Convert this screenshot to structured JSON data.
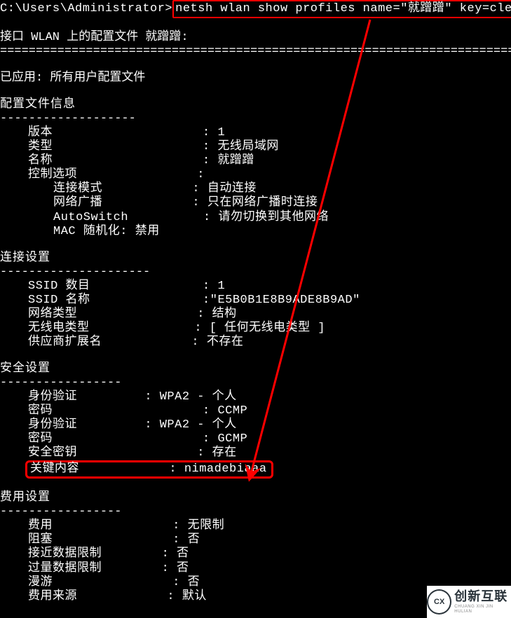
{
  "prompt": {
    "path": "C:\\Users\\Administrator>",
    "command": "netsh wlan show profiles name=\"就蹭蹭\" key=clear"
  },
  "header_line": "接口 WLAN 上的配置文件 就蹭蹭:",
  "hr_full": "=========================================================================",
  "applied": "已应用: 所有用户配置文件",
  "sec_profile": {
    "title": "配置文件信息",
    "hr": "-------------------",
    "rows": {
      "version_k": "版本",
      "version_v": "1",
      "type_k": "类型",
      "type_v": "无线局域网",
      "name_k": "名称",
      "name_v": "就蹭蹭",
      "ctrl_k": "控制选项",
      "ctrl_v": "",
      "conn_mode_k": "连接模式",
      "conn_mode_v": "自动连接",
      "broadcast_k": "网络广播",
      "broadcast_v": "只在网络广播时连接",
      "autoswitch_k": "AutoSwitch",
      "autoswitch_v": "请勿切换到其他网络",
      "macrand_line": "MAC 随机化: 禁用"
    }
  },
  "sec_conn": {
    "title": "连接设置",
    "hr": "---------------------",
    "rows": {
      "ssid_cnt_k": "SSID 数目",
      "ssid_cnt_v": "1",
      "ssid_name_k": "SSID 名称",
      "ssid_name_v": "\"E5B0B1E8B9ADE8B9AD\"",
      "net_type_k": "网络类型",
      "net_type_v": "结构",
      "radio_k": "无线电类型",
      "radio_v": "[ 任何无线电类型 ]",
      "vendor_k": "供应商扩展名",
      "vendor_v": "不存在"
    }
  },
  "sec_sec": {
    "title": "安全设置",
    "hr": "-----------------",
    "rows": {
      "auth1_k": "身份验证",
      "auth1_v": "WPA2 - 个人",
      "cipher1_k": "密码",
      "cipher1_v": "CCMP",
      "auth2_k": "身份验证",
      "auth2_v": "WPA2 - 个人",
      "cipher2_k": "密码",
      "cipher2_v": "GCMP",
      "key_exist_k": "安全密钥",
      "key_exist_v": "存在",
      "key_content_k": "关键内容",
      "key_content_v": "nimadebiaaa"
    }
  },
  "sec_cost": {
    "title": "费用设置",
    "hr": "-----------------",
    "rows": {
      "cost_k": "费用",
      "cost_v": "无限制",
      "congest_k": "阻塞",
      "congest_v": "否",
      "near_k": "接近数据限制",
      "near_v": "否",
      "over_k": "过量数据限制",
      "over_v": "否",
      "roam_k": "漫游",
      "roam_v": "否",
      "source_k": "费用来源",
      "source_v": "默认"
    }
  },
  "watermark": {
    "brand": "创新互联",
    "sub": "CHUANG XIN JIN HULIAN",
    "logo": "CX"
  }
}
